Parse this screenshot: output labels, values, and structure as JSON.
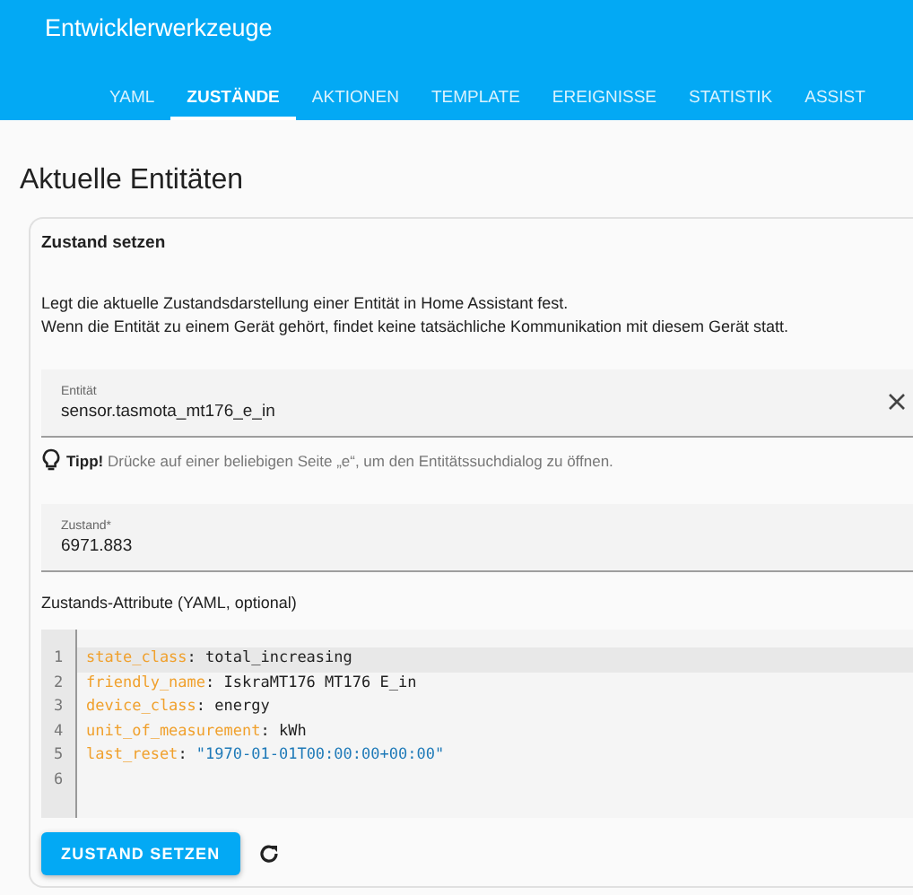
{
  "header": {
    "title": "Entwicklerwerkzeuge"
  },
  "tabs": [
    {
      "label": "YAML",
      "selected": false
    },
    {
      "label": "ZUSTÄNDE",
      "selected": true
    },
    {
      "label": "AKTIONEN",
      "selected": false
    },
    {
      "label": "TEMPLATE",
      "selected": false
    },
    {
      "label": "EREIGNISSE",
      "selected": false
    },
    {
      "label": "STATISTIK",
      "selected": false
    },
    {
      "label": "ASSIST",
      "selected": false
    }
  ],
  "page_title": "Aktuelle Entitäten",
  "card": {
    "title": "Zustand setzen",
    "description": [
      "Legt die aktuelle Zustandsdarstellung einer Entität in Home Assistant fest.",
      "Wenn die Entität zu einem Gerät gehört, findet keine tatsächliche Kommunikation mit diesem Gerät statt."
    ],
    "entity_field": {
      "label": "Entität",
      "value": "sensor.tasmota_mt176_e_in"
    },
    "tip": "**Tipp!** Drücke auf einer beliebigen Seite „e“, um den Entitätssuchdialog zu öffnen.",
    "state_field": {
      "label": "Zustand*",
      "value": "6971.883"
    },
    "attributes_label": "Zustands-Attribute (YAML, optional)",
    "code_lines": [
      {
        "number": "1",
        "key": "state_class",
        "punct": ":",
        "value": "total_increasing",
        "quoted": false,
        "active": true
      },
      {
        "number": "2",
        "key": "friendly_name",
        "punct": ":",
        "value": "IskraMT176 MT176 E_in",
        "quoted": false,
        "active": false
      },
      {
        "number": "3",
        "key": "device_class",
        "punct": ":",
        "value": "energy",
        "quoted": false,
        "active": false
      },
      {
        "number": "4",
        "key": "unit_of_measurement",
        "punct": ":",
        "value": "kWh",
        "quoted": false,
        "active": false
      },
      {
        "number": "5",
        "key": "last_reset",
        "punct": ":",
        "value": "\"1970-01-01T00:00:00+00:00\"",
        "quoted": true,
        "active": false
      },
      {
        "number": "6",
        "active": false
      }
    ],
    "submit_button": "ZUSTAND SETZEN"
  }
}
